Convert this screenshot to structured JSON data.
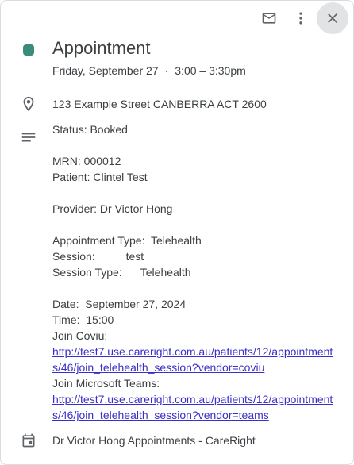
{
  "toolbar": {
    "email_icon": "email-icon",
    "more_icon": "more-vert-icon",
    "close_icon": "close-icon"
  },
  "event": {
    "color": "#3b8b7a",
    "title": "Appointment",
    "date": "Friday, September 27",
    "separator": "·",
    "time": "3:00 – 3:30pm",
    "location": "123 Example Street CANBERRA ACT 2600"
  },
  "description": {
    "status": "Status: Booked",
    "mrn": "MRN: 000012",
    "patient": "Patient: Clintel Test",
    "provider": "Provider: Dr Victor Hong",
    "appointment_type": "Appointment Type:  Telehealth",
    "session": "Session:          test",
    "session_type": "Session Type:      Telehealth",
    "date": "Date:  September 27, 2024",
    "time": "Time:  15:00",
    "join_coviu_label": "Join Coviu:",
    "join_coviu_link": "http://test7.use.careright.com.au/patients/12/appointments/46/join_telehealth_session?vendor=coviu",
    "join_teams_label": "Join Microsoft Teams:",
    "join_teams_link": "http://test7.use.careright.com.au/patients/12/appointments/46/join_telehealth_session?vendor=teams"
  },
  "calendar": {
    "name": "Dr Victor Hong Appointments - CareRight"
  }
}
